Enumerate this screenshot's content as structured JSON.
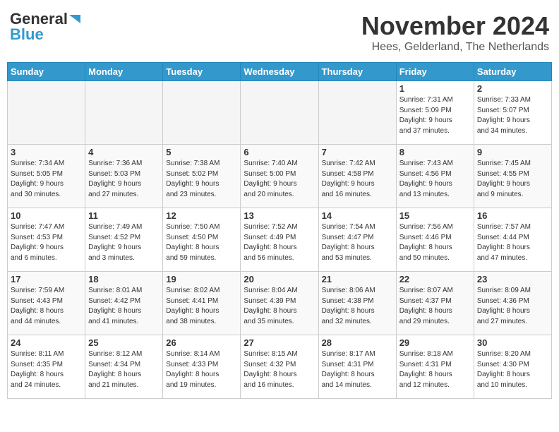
{
  "header": {
    "logo_general": "General",
    "logo_blue": "Blue",
    "month_title": "November 2024",
    "location": "Hees, Gelderland, The Netherlands"
  },
  "weekdays": [
    "Sunday",
    "Monday",
    "Tuesday",
    "Wednesday",
    "Thursday",
    "Friday",
    "Saturday"
  ],
  "weeks": [
    [
      {
        "day": "",
        "info": ""
      },
      {
        "day": "",
        "info": ""
      },
      {
        "day": "",
        "info": ""
      },
      {
        "day": "",
        "info": ""
      },
      {
        "day": "",
        "info": ""
      },
      {
        "day": "1",
        "info": "Sunrise: 7:31 AM\nSunset: 5:09 PM\nDaylight: 9 hours\nand 37 minutes."
      },
      {
        "day": "2",
        "info": "Sunrise: 7:33 AM\nSunset: 5:07 PM\nDaylight: 9 hours\nand 34 minutes."
      }
    ],
    [
      {
        "day": "3",
        "info": "Sunrise: 7:34 AM\nSunset: 5:05 PM\nDaylight: 9 hours\nand 30 minutes."
      },
      {
        "day": "4",
        "info": "Sunrise: 7:36 AM\nSunset: 5:03 PM\nDaylight: 9 hours\nand 27 minutes."
      },
      {
        "day": "5",
        "info": "Sunrise: 7:38 AM\nSunset: 5:02 PM\nDaylight: 9 hours\nand 23 minutes."
      },
      {
        "day": "6",
        "info": "Sunrise: 7:40 AM\nSunset: 5:00 PM\nDaylight: 9 hours\nand 20 minutes."
      },
      {
        "day": "7",
        "info": "Sunrise: 7:42 AM\nSunset: 4:58 PM\nDaylight: 9 hours\nand 16 minutes."
      },
      {
        "day": "8",
        "info": "Sunrise: 7:43 AM\nSunset: 4:56 PM\nDaylight: 9 hours\nand 13 minutes."
      },
      {
        "day": "9",
        "info": "Sunrise: 7:45 AM\nSunset: 4:55 PM\nDaylight: 9 hours\nand 9 minutes."
      }
    ],
    [
      {
        "day": "10",
        "info": "Sunrise: 7:47 AM\nSunset: 4:53 PM\nDaylight: 9 hours\nand 6 minutes."
      },
      {
        "day": "11",
        "info": "Sunrise: 7:49 AM\nSunset: 4:52 PM\nDaylight: 9 hours\nand 3 minutes."
      },
      {
        "day": "12",
        "info": "Sunrise: 7:50 AM\nSunset: 4:50 PM\nDaylight: 8 hours\nand 59 minutes."
      },
      {
        "day": "13",
        "info": "Sunrise: 7:52 AM\nSunset: 4:49 PM\nDaylight: 8 hours\nand 56 minutes."
      },
      {
        "day": "14",
        "info": "Sunrise: 7:54 AM\nSunset: 4:47 PM\nDaylight: 8 hours\nand 53 minutes."
      },
      {
        "day": "15",
        "info": "Sunrise: 7:56 AM\nSunset: 4:46 PM\nDaylight: 8 hours\nand 50 minutes."
      },
      {
        "day": "16",
        "info": "Sunrise: 7:57 AM\nSunset: 4:44 PM\nDaylight: 8 hours\nand 47 minutes."
      }
    ],
    [
      {
        "day": "17",
        "info": "Sunrise: 7:59 AM\nSunset: 4:43 PM\nDaylight: 8 hours\nand 44 minutes."
      },
      {
        "day": "18",
        "info": "Sunrise: 8:01 AM\nSunset: 4:42 PM\nDaylight: 8 hours\nand 41 minutes."
      },
      {
        "day": "19",
        "info": "Sunrise: 8:02 AM\nSunset: 4:41 PM\nDaylight: 8 hours\nand 38 minutes."
      },
      {
        "day": "20",
        "info": "Sunrise: 8:04 AM\nSunset: 4:39 PM\nDaylight: 8 hours\nand 35 minutes."
      },
      {
        "day": "21",
        "info": "Sunrise: 8:06 AM\nSunset: 4:38 PM\nDaylight: 8 hours\nand 32 minutes."
      },
      {
        "day": "22",
        "info": "Sunrise: 8:07 AM\nSunset: 4:37 PM\nDaylight: 8 hours\nand 29 minutes."
      },
      {
        "day": "23",
        "info": "Sunrise: 8:09 AM\nSunset: 4:36 PM\nDaylight: 8 hours\nand 27 minutes."
      }
    ],
    [
      {
        "day": "24",
        "info": "Sunrise: 8:11 AM\nSunset: 4:35 PM\nDaylight: 8 hours\nand 24 minutes."
      },
      {
        "day": "25",
        "info": "Sunrise: 8:12 AM\nSunset: 4:34 PM\nDaylight: 8 hours\nand 21 minutes."
      },
      {
        "day": "26",
        "info": "Sunrise: 8:14 AM\nSunset: 4:33 PM\nDaylight: 8 hours\nand 19 minutes."
      },
      {
        "day": "27",
        "info": "Sunrise: 8:15 AM\nSunset: 4:32 PM\nDaylight: 8 hours\nand 16 minutes."
      },
      {
        "day": "28",
        "info": "Sunrise: 8:17 AM\nSunset: 4:31 PM\nDaylight: 8 hours\nand 14 minutes."
      },
      {
        "day": "29",
        "info": "Sunrise: 8:18 AM\nSunset: 4:31 PM\nDaylight: 8 hours\nand 12 minutes."
      },
      {
        "day": "30",
        "info": "Sunrise: 8:20 AM\nSunset: 4:30 PM\nDaylight: 8 hours\nand 10 minutes."
      }
    ]
  ]
}
